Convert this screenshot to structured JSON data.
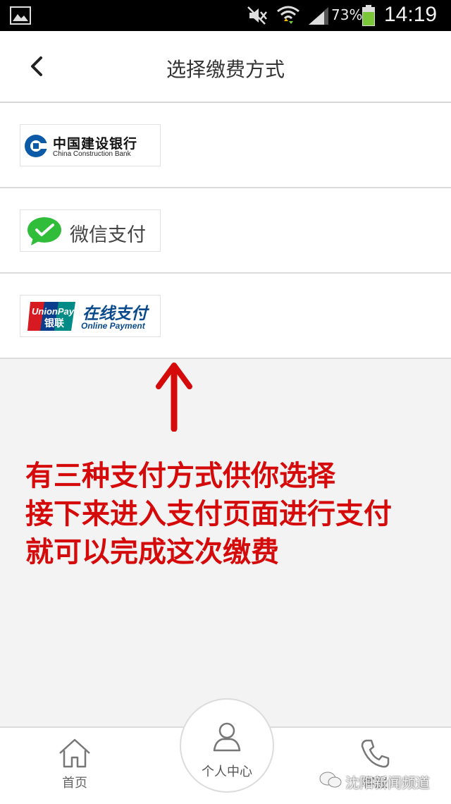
{
  "status_bar": {
    "battery_percent": "73%",
    "time": "14:19"
  },
  "header": {
    "title": "选择缴费方式"
  },
  "payment_options": [
    {
      "id": "ccb",
      "name_cn": "中国建设银行",
      "name_en": "China Construction Bank",
      "brand_color": "#0a5aa8"
    },
    {
      "id": "wechat",
      "name_cn": "微信支付",
      "brand_color": "#2fbd3a"
    },
    {
      "id": "unionpay",
      "badge_top": "UnionPay",
      "badge_bottom": "银联",
      "name_cn": "在线支付",
      "name_en": "Online Payment",
      "brand_color": "#0a4a8c"
    }
  ],
  "annotation": {
    "lines": [
      "有三种支付方式供你选择",
      "接下来进入支付页面进行支付",
      "就可以完成这次缴费"
    ],
    "color": "#d50b0b"
  },
  "bottom_nav": {
    "home_label": "首页",
    "center_label": "个人中心",
    "service_label": "客服"
  },
  "watermark": "沈阳新闻频道"
}
